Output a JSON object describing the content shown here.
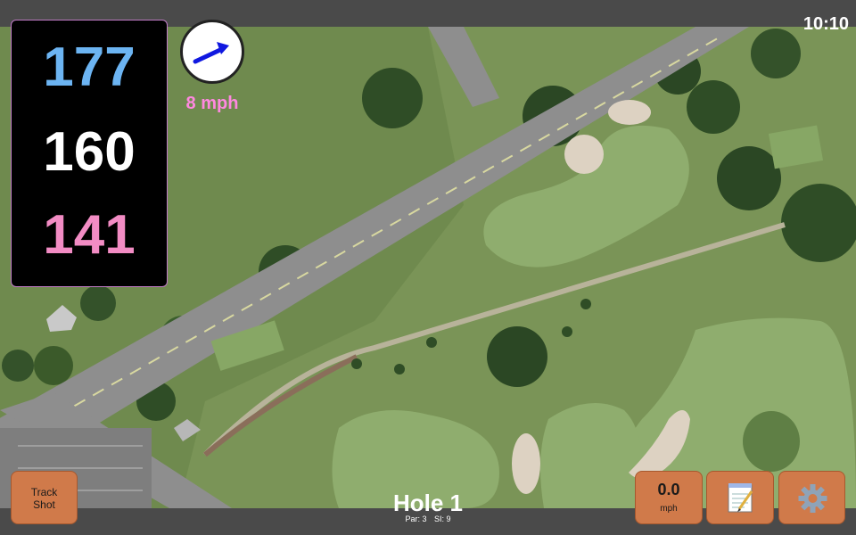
{
  "status": {
    "clock": "10:10"
  },
  "yardages": {
    "back": "177",
    "middle": "160",
    "front": "141"
  },
  "wind": {
    "speed_label": "8 mph",
    "direction_icon": "arrow-northeast-icon",
    "arrow_color": "#1018e0"
  },
  "buttons": {
    "track_shot_line1": "Track",
    "track_shot_line2": "Shot",
    "speed_value": "0.0",
    "speed_unit": "mph",
    "notes_icon": "notepad-icon",
    "settings_icon": "gear-icon"
  },
  "hole": {
    "title": "Hole 1",
    "par": "Par: 3",
    "si": "SI: 9"
  },
  "colors": {
    "accent_orange": "#d07a4a",
    "yardage_back": "#6cb4f2",
    "yardage_front": "#f28cc4",
    "wind_speed_text": "#ff88e0"
  }
}
